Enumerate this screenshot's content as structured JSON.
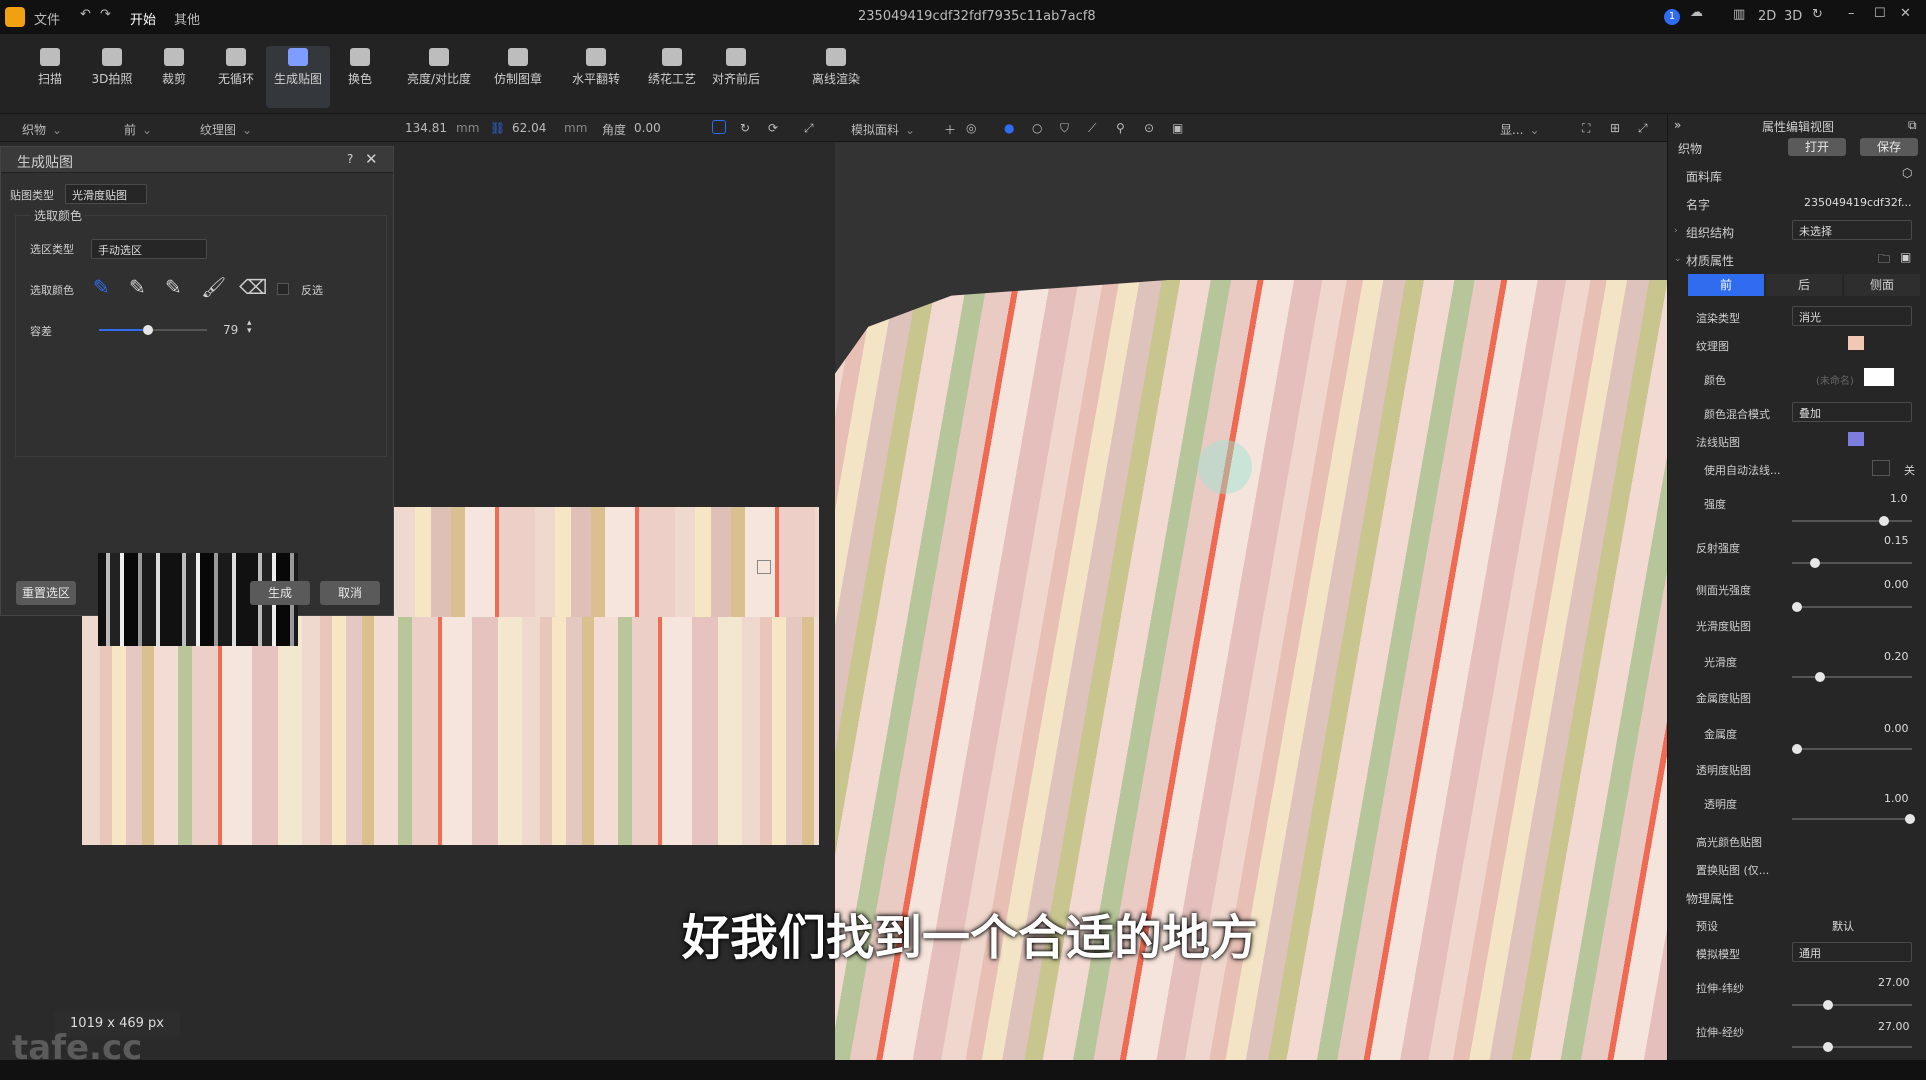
{
  "titlebar": {
    "menu_file": "文件",
    "menu_start": "开始",
    "menu_other": "其他",
    "doc_title": "235049419cdf32fdf7935c11ab7acf8",
    "badge": "1",
    "mode_2d": "2D",
    "mode_3d": "3D"
  },
  "toolbar": {
    "tools": [
      {
        "label": "扫描",
        "icon": "scan-icon"
      },
      {
        "label": "3D拍照",
        "icon": "camera-icon"
      },
      {
        "label": "裁剪",
        "icon": "crop-icon"
      },
      {
        "label": "无循环",
        "icon": "seamless-icon"
      },
      {
        "label": "生成贴图",
        "icon": "generate-map-icon",
        "active": true
      },
      {
        "label": "换色",
        "icon": "recolor-icon"
      },
      {
        "label": "亮度/对比度",
        "icon": "brightness-icon"
      },
      {
        "label": "仿制图章",
        "icon": "clone-stamp-icon"
      },
      {
        "label": "水平翻转",
        "icon": "flip-icon"
      },
      {
        "label": "绣花工艺",
        "icon": "embroidery-icon"
      },
      {
        "label": "对齐前后",
        "icon": "align-icon"
      },
      {
        "label": "离线渲染",
        "icon": "render-icon"
      }
    ]
  },
  "subbar": {
    "fabric": "织物",
    "side": "前",
    "map": "纹理图",
    "width": "134.81",
    "unit1": "mm",
    "height": "62.04",
    "unit2": "mm",
    "angle_label": "角度",
    "angle": "0.00",
    "sim_fabric": "模拟面料",
    "view_label": "显..."
  },
  "dialog": {
    "title": "生成贴图",
    "help": "?",
    "map_type_label": "贴图类型",
    "map_type": "光滑度贴图",
    "pick_color_group": "选取颜色",
    "select_type_label": "选区类型",
    "select_type": "手动选区",
    "pick_color_label": "选取颜色",
    "invert_label": "反选",
    "tolerance_label": "容差",
    "tolerance": "79",
    "tolerance_fraction": 0.45,
    "reset_btn": "重置选区",
    "generate_btn": "生成",
    "cancel_btn": "取消"
  },
  "status": {
    "image_size": "1019 x 469 px",
    "watermark": "tafe.cc"
  },
  "subtitle": "好我们找到一个合适的地方",
  "panel": {
    "title": "属性编辑视图",
    "fabric": "织物",
    "open_btn": "打开",
    "save_btn": "保存",
    "library": "面料库",
    "name_label": "名字",
    "name_value": "235049419cdf32f...",
    "structure_label": "组织结构",
    "structure_value": "未选择",
    "material_label": "材质属性",
    "tabs": [
      "前",
      "后",
      "侧面"
    ],
    "render_type_label": "渲染类型",
    "render_type": "消光",
    "texture_label": "纹理图",
    "color_label": "颜色",
    "color_value": "(未命名)",
    "blend_label": "颜色混合模式",
    "blend_value": "叠加",
    "normal_label": "法线贴图",
    "auto_normal_label": "使用自动法线...",
    "auto_normal_state": "关",
    "strength_label": "强度",
    "strength": "1.0",
    "strength_fraction": 0.77,
    "reflect_label": "反射强度",
    "reflect": "0.15",
    "reflect_fraction": 0.19,
    "side_light_label": "侧面光强度",
    "side_light": "0.00",
    "side_light_fraction": 0.04,
    "smooth_map_label": "光滑度贴图",
    "smooth_label": "光滑度",
    "smooth": "0.20",
    "smooth_fraction": 0.23,
    "metal_map_label": "金属度贴图",
    "metal_label": "金属度",
    "metal": "0.00",
    "metal_fraction": 0.04,
    "transp_map_label": "透明度贴图",
    "transp_label": "透明度",
    "transp": "1.00",
    "transp_fraction": 0.98,
    "spec_color_label": "高光颜色贴图",
    "displace_label": "置换贴图 (仅...",
    "physics_label": "物理属性",
    "preset_label": "预设",
    "preset_value": "默认",
    "model_label": "模拟模型",
    "model_value": "通用",
    "warp_label": "拉伸-纬纱",
    "warp": "27.00",
    "warp_fraction": 0.3,
    "weft_label": "拉伸-经纱",
    "weft": "27.00",
    "weft_fraction": 0.3
  },
  "colors": {
    "accent": "#2f6cf0",
    "stripe_red": "#f06d55",
    "stripe_green": "#b7c59a",
    "stripe_yellow": "#d9c08e"
  }
}
